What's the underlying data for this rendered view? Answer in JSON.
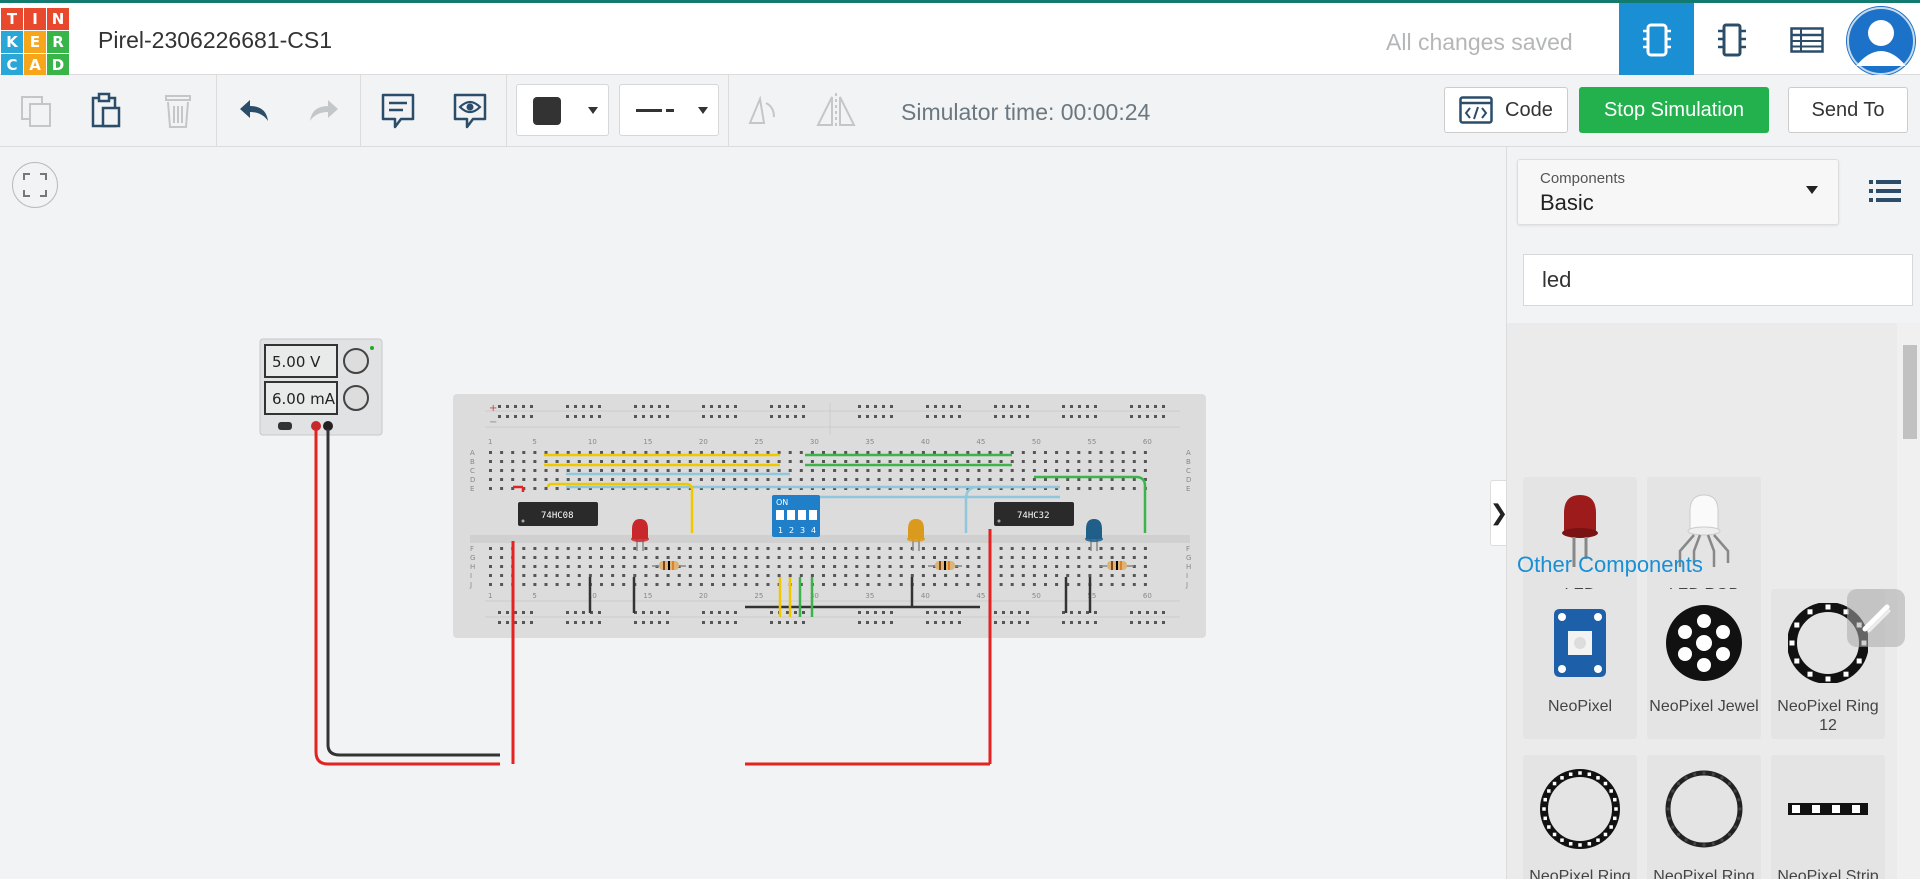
{
  "logo": {
    "letters": [
      "T",
      "I",
      "N",
      "K",
      "E",
      "R",
      "C",
      "A",
      "D"
    ],
    "colors": [
      "#e8482b",
      "#e8482b",
      "#e8482b",
      "#2aa7d6",
      "#f7a61b",
      "#38b449",
      "#2aa7d6",
      "#f7a61b",
      "#38b449"
    ]
  },
  "header": {
    "project_title": "Pirel-2306226681-CS1",
    "save_status": "All changes saved",
    "accent": "#1a8fd4"
  },
  "toolbar": {
    "simulator_time": "Simulator time: 00:00:24",
    "code_label": "Code",
    "stop_label": "Stop Simulation",
    "send_label": "Send To",
    "stop_color": "#23b14d"
  },
  "circuit": {
    "psu": {
      "voltage": "5.00 V",
      "current": "6.00 mA"
    },
    "chips": [
      "74HC08",
      "74HC32"
    ],
    "switch_label": "ON",
    "switch_numbers": [
      "1",
      "2",
      "3",
      "4"
    ],
    "row_letters": [
      "A",
      "B",
      "C",
      "D",
      "E",
      "F",
      "G",
      "H",
      "I",
      "J"
    ],
    "column_numbers": [
      "1",
      "5",
      "10",
      "15",
      "20",
      "25",
      "30",
      "35",
      "40",
      "45",
      "50",
      "55",
      "60"
    ],
    "led_colors": [
      "#c8282b",
      "#d99a1d",
      "#1f5f8a"
    ]
  },
  "panel": {
    "components_label": "Components",
    "components_value": "Basic",
    "search_value": "led",
    "other_components_title": "Other Components",
    "basic_items": [
      {
        "label": "LED",
        "icon": "led-red-icon"
      },
      {
        "label": "LED RGB",
        "icon": "led-rgb-icon"
      }
    ],
    "other_items": [
      {
        "label": "NeoPixel",
        "icon": "neopixel-icon"
      },
      {
        "label": "NeoPixel Jewel",
        "icon": "neopixel-jewel-icon"
      },
      {
        "label": "NeoPixel Ring 12",
        "icon": "neopixel-ring-icon"
      },
      {
        "label": "NeoPixel Ring",
        "icon": "neopixel-ring-24-icon"
      },
      {
        "label": "NeoPixel Ring",
        "icon": "neopixel-ring-16-icon"
      },
      {
        "label": "NeoPixel Strip",
        "icon": "neopixel-strip-icon"
      }
    ]
  }
}
